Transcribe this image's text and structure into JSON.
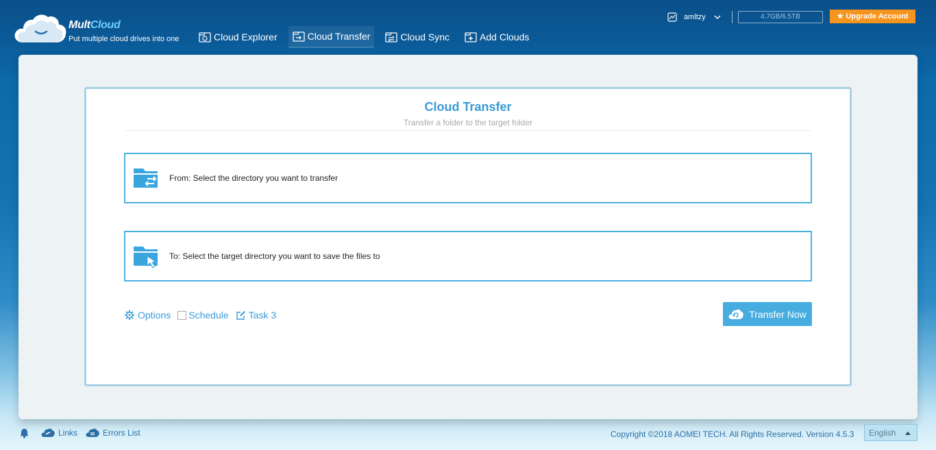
{
  "app": {
    "logo_main": "Mult",
    "logo_accent": "Cloud",
    "tagline": "Put multiple cloud drives into one"
  },
  "nav": [
    {
      "label": "Cloud Explorer",
      "icon": "cloud-explorer-icon",
      "active": false
    },
    {
      "label": "Cloud Transfer",
      "icon": "cloud-transfer-icon",
      "active": true
    },
    {
      "label": "Cloud Sync",
      "icon": "cloud-sync-icon",
      "active": false
    },
    {
      "label": "Add Clouds",
      "icon": "add-clouds-icon",
      "active": false
    }
  ],
  "user": {
    "name": "amltzy",
    "storage": "4.7GB/6.5TB",
    "upgrade_label": "★ Upgrade Account"
  },
  "transfer": {
    "title": "Cloud Transfer",
    "subtitle": "Transfer a folder to the target folder",
    "from_text": "From: Select the directory you want to transfer",
    "to_text": "To: Select the target directory you want to save the files to",
    "options_label": "Options",
    "schedule_label": "Schedule",
    "schedule_checked": false,
    "task_label": "Task 3",
    "transfer_now_label": "Transfer Now"
  },
  "footer": {
    "links_label": "Links",
    "errors_label": "Errors List",
    "copyright": "Copyright ©2018 AOMEI TECH. All Rights Reserved. Version 4.5.3",
    "language": "English"
  },
  "colors": {
    "accent": "#3c9bd6",
    "button": "#47ade0",
    "upgrade": "#f7941d",
    "box_border": "#4ab0de"
  }
}
